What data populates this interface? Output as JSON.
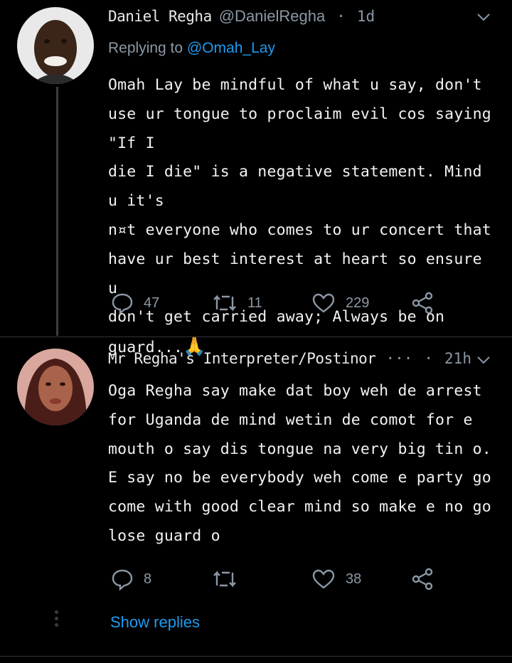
{
  "tweet1": {
    "author": "Daniel Regha",
    "handle": "@DanielRegha",
    "separator": "·",
    "time": "1d",
    "replying_prefix": "Replying to",
    "replying_mention": "@Omah_Lay",
    "text": "Omah Lay be mindful of what u say, don't\nuse ur tongue to proclaim evil cos saying \"If I\ndie I die\" is a negative statement. Mind u it's\nn¤t everyone who comes to ur concert that\nhave ur best interest at heart so ensure u\ndon't get carried away; Always be on\nguard...",
    "emoji": "🙏",
    "replies": "47",
    "retweets": "11",
    "likes": "229"
  },
  "tweet2": {
    "author": "Mr Regha's Interpreter/Postinor",
    "ellipsis": "···",
    "separator": "·",
    "time": "21h",
    "text": "Oga Regha say make dat boy weh de arrest\nfor Uganda de mind wetin de comot for e\nmouth o say dis tongue na very big tin o.\nE say no be everybody weh come e party go\ncome with good clear mind so make e no go\nlose guard o",
    "replies": "8",
    "retweets": "",
    "likes": "38"
  },
  "show_replies": "Show replies",
  "colors": {
    "background": "#000000",
    "text": "#e7e9ea",
    "muted": "#8b98a5",
    "link": "#1d9bf0"
  }
}
